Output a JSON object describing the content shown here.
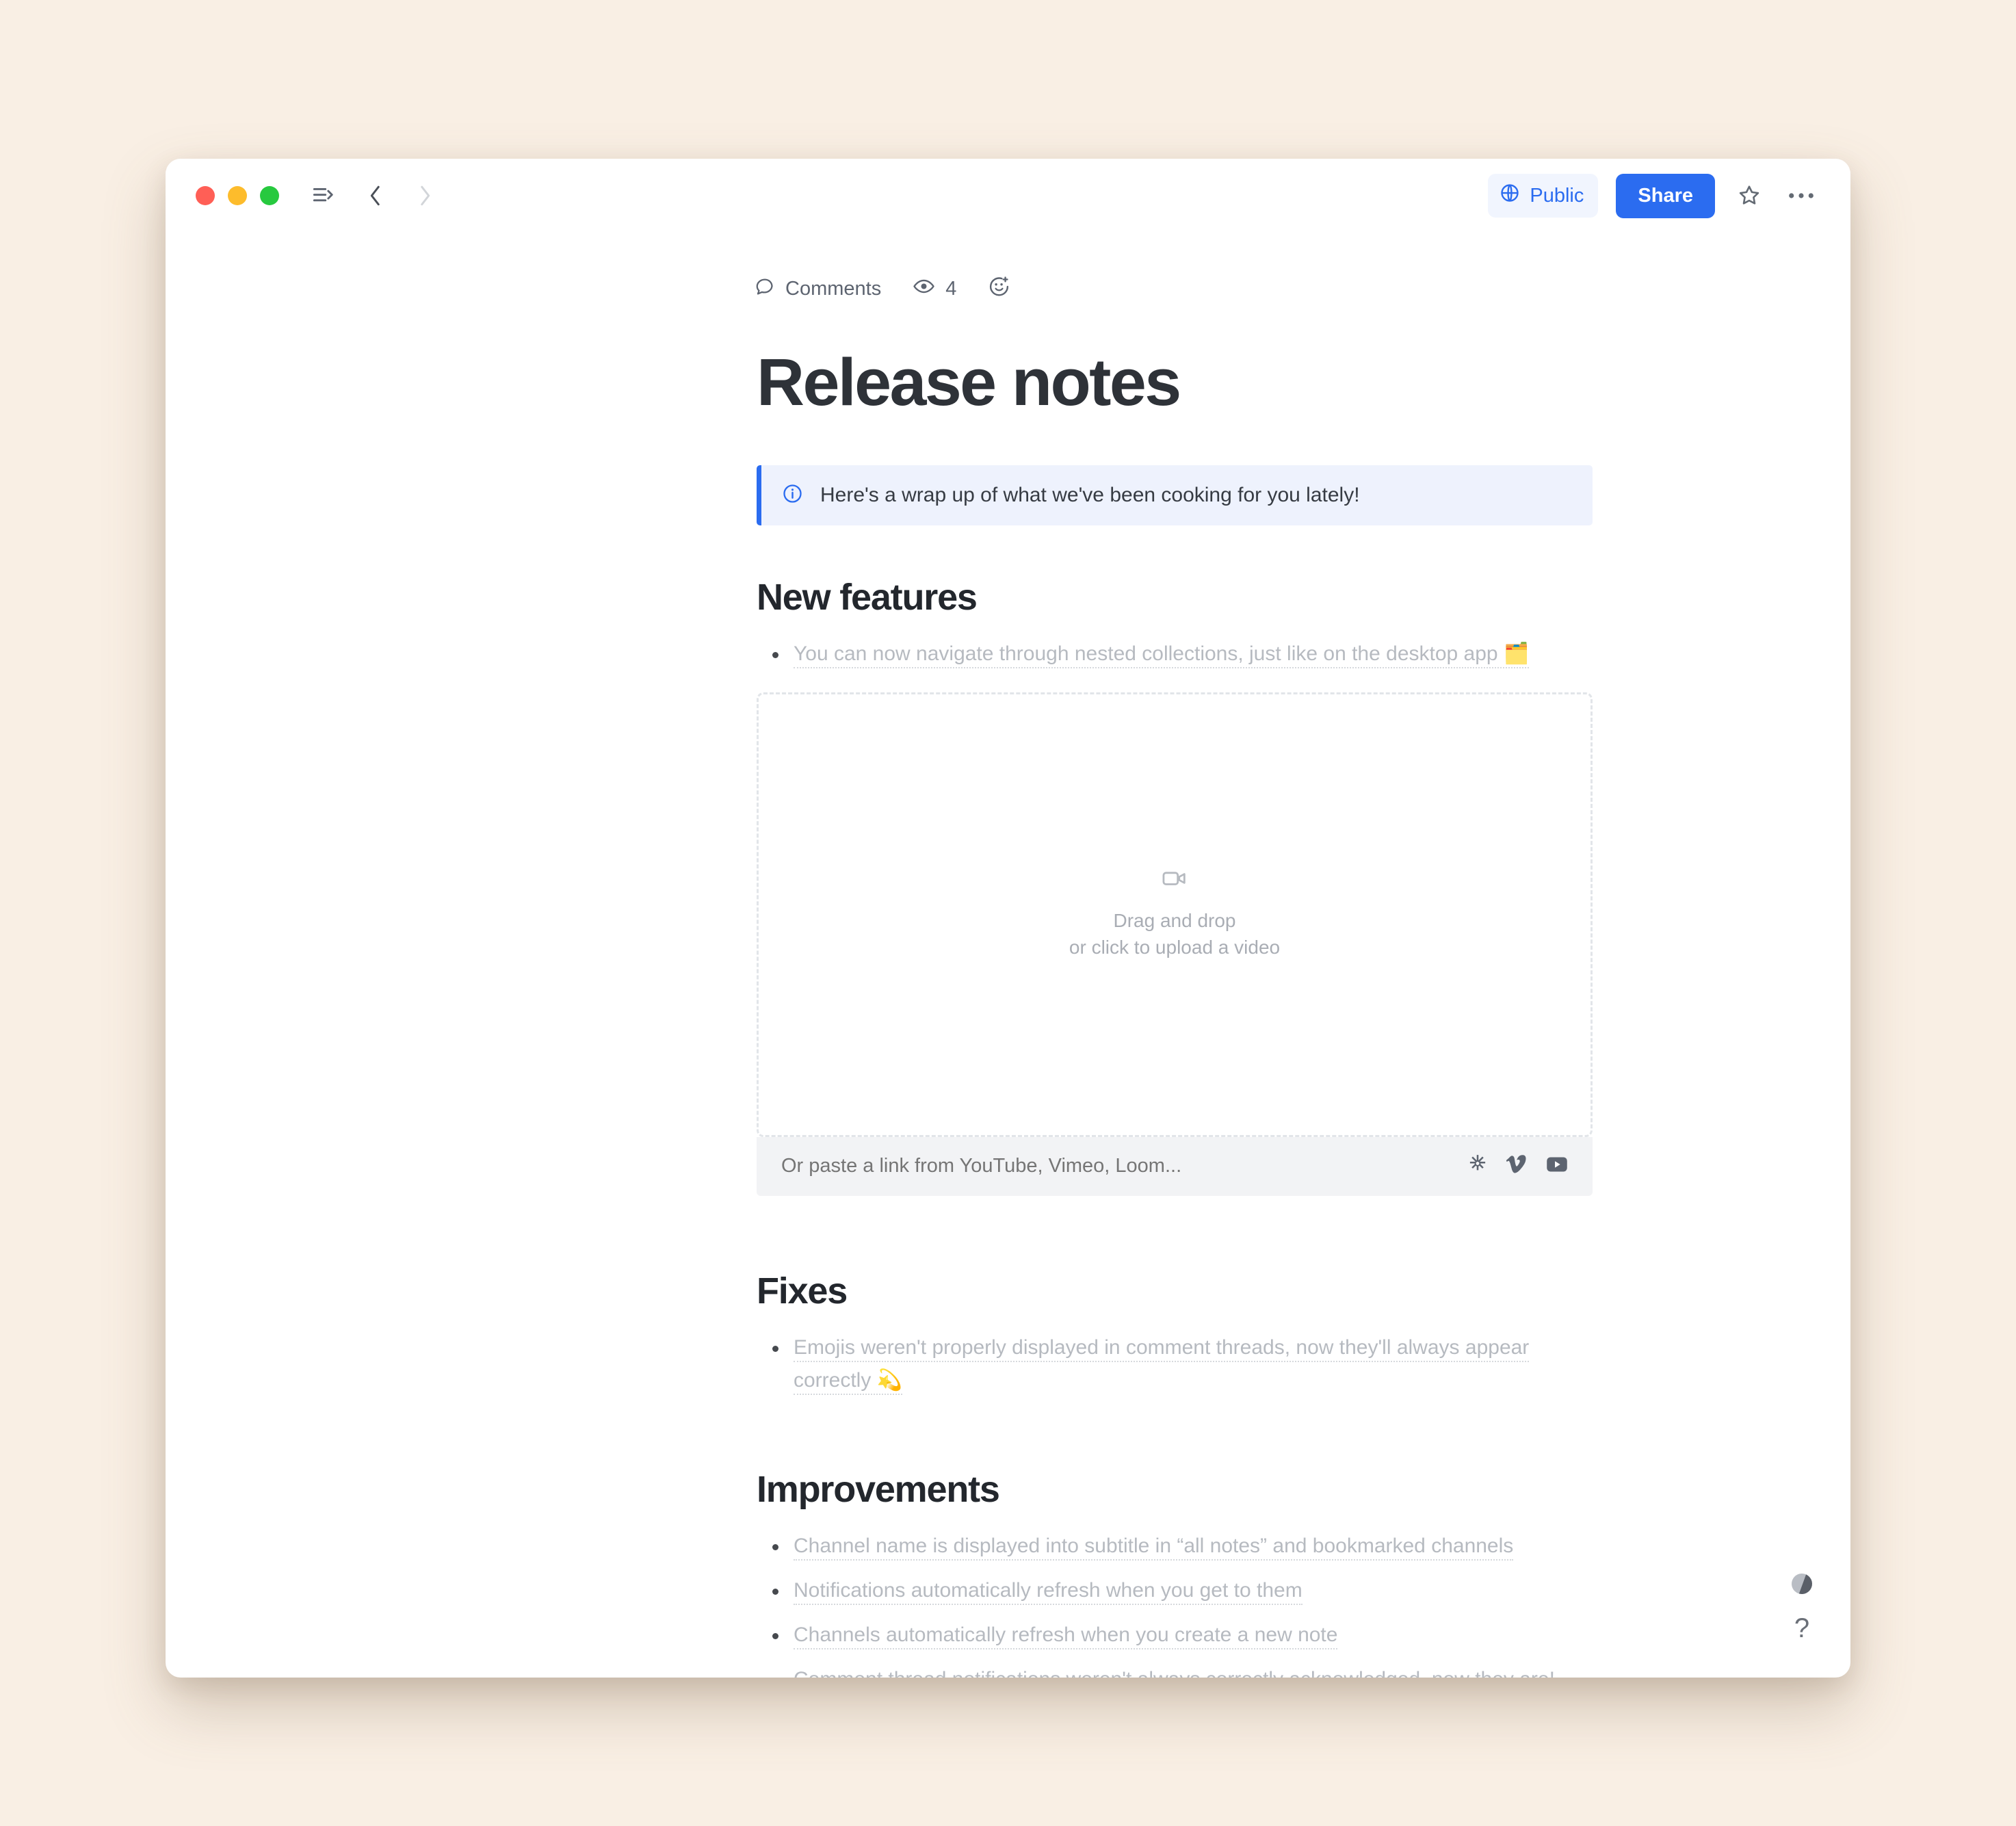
{
  "window": {
    "traffic_lights": [
      "close",
      "minimize",
      "maximize"
    ],
    "sidebar_toggle": "sidebar-toggle-icon",
    "back": "back-chevron-icon",
    "forward": "forward-chevron-icon"
  },
  "toolbar": {
    "visibility_label": "Public",
    "visibility_icon": "globe-icon",
    "share_label": "Share",
    "favorite_icon": "star-icon",
    "more_icon": "ellipsis-icon"
  },
  "meta": {
    "comments_label": "Comments",
    "comments_icon": "speech-bubble-icon",
    "views_icon": "eye-icon",
    "views_count": "4",
    "reaction_icon": "add-reaction-icon"
  },
  "document": {
    "title": "Release notes",
    "callout": {
      "icon": "info-icon",
      "text": "Here's a wrap up of what we've been cooking for you lately!"
    },
    "sections": [
      {
        "heading": "New features",
        "items": [
          {
            "text": "You can now navigate through nested collections, just like on the desktop app ",
            "emoji": "🗂️"
          }
        ]
      },
      {
        "heading": "Fixes",
        "items": [
          {
            "text": "Emojis weren't properly displayed in comment threads, now they'll always appear correctly ",
            "emoji": "💫"
          }
        ]
      },
      {
        "heading": "Improvements",
        "items": [
          {
            "text": "Channel name is displayed into subtitle in “all notes” and bookmarked channels",
            "emoji": ""
          },
          {
            "text": "Notifications automatically refresh when you get to them",
            "emoji": ""
          },
          {
            "text": "Channels automatically refresh when you create a new note",
            "emoji": ""
          },
          {
            "text": "Comment thread notifications weren't always correctly acknowledged, now they are!",
            "emoji": ""
          }
        ]
      }
    ]
  },
  "video_embed": {
    "icon": "video-camera-icon",
    "drag_line1": "Drag and drop",
    "drag_line2": "or click to upload a video",
    "paste_placeholder": "Or paste a link from YouTube, Vimeo, Loom...",
    "services": [
      "loom-icon",
      "vimeo-icon",
      "youtube-icon"
    ]
  },
  "helpers": {
    "badge": "status-badge",
    "help_label": "?"
  },
  "colors": {
    "accent_blue": "#2b6cf0",
    "callout_bg": "#eef2fd",
    "page_bg": "#f9efe4",
    "muted_text": "#b6bac0"
  }
}
